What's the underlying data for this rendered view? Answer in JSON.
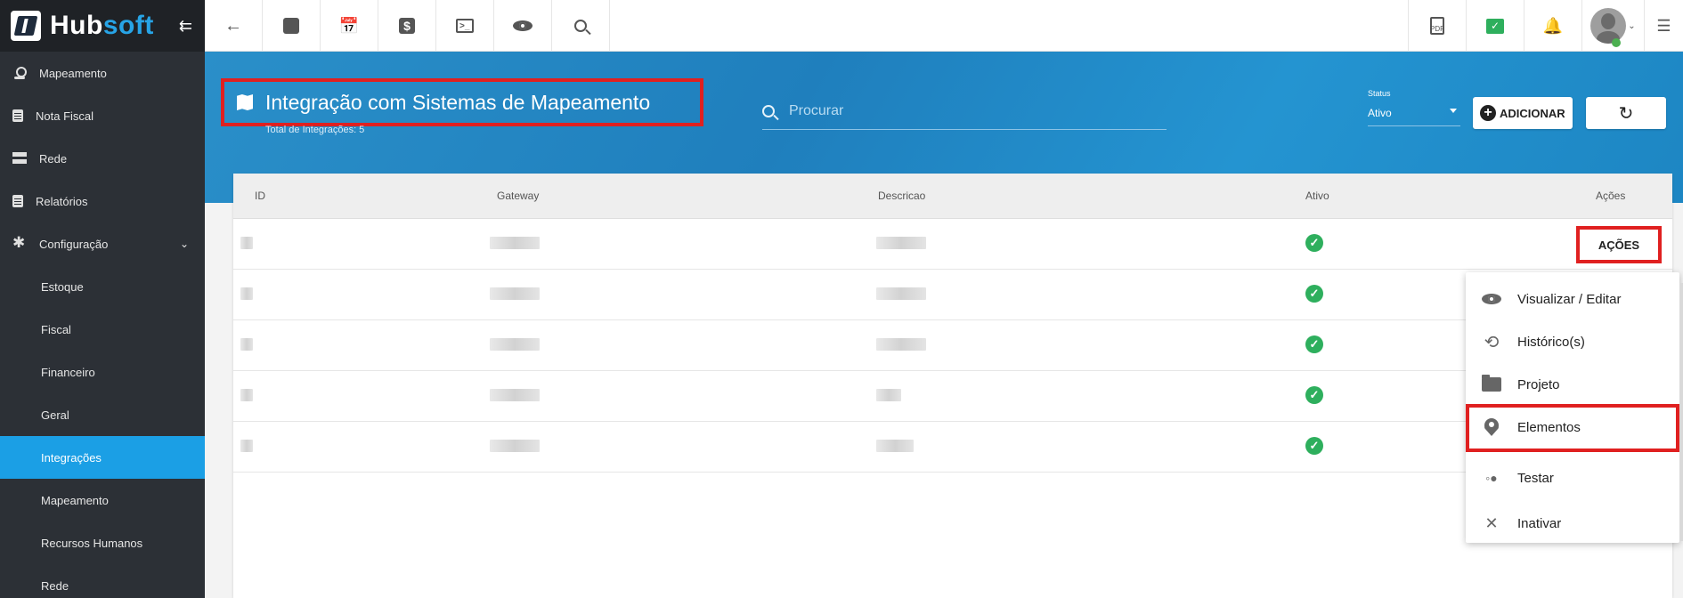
{
  "brand": {
    "name_part1": "Hub",
    "name_part2": "soft"
  },
  "sidebar": {
    "items": [
      {
        "label": "Mapeamento",
        "icon": "map-pin-icon"
      },
      {
        "label": "Nota Fiscal",
        "icon": "document-icon"
      },
      {
        "label": "Rede",
        "icon": "network-icon"
      },
      {
        "label": "Relatórios",
        "icon": "report-icon"
      },
      {
        "label": "Configuração",
        "icon": "gear-icon",
        "expanded": true
      }
    ],
    "subitems": [
      {
        "label": "Estoque"
      },
      {
        "label": "Fiscal"
      },
      {
        "label": "Financeiro"
      },
      {
        "label": "Geral"
      },
      {
        "label": "Integrações",
        "active": true
      },
      {
        "label": "Mapeamento"
      },
      {
        "label": "Recursos Humanos"
      },
      {
        "label": "Rede"
      }
    ]
  },
  "topbar": {
    "buttons": [
      "back-arrow-icon",
      "contact-card-icon",
      "calendar-clock-icon",
      "money-icon",
      "terminal-icon",
      "eye-icon",
      "search-icon"
    ],
    "right_buttons": [
      "pdf-icon",
      "chat-icon",
      "bell-icon",
      "avatar"
    ]
  },
  "header": {
    "title": "Integração com Sistemas de Mapeamento",
    "subtitle": "Total de Integrações: 5",
    "search_placeholder": "Procurar",
    "status_label": "Status",
    "status_value": "Ativo",
    "add_label": "ADICIONAR"
  },
  "table": {
    "columns": [
      "ID",
      "Gateway",
      "Descricao",
      "Ativo",
      "Ações"
    ],
    "rows": [
      {
        "ativo": true,
        "acoes": "AÇÕES"
      },
      {
        "ativo": true
      },
      {
        "ativo": true
      },
      {
        "ativo": true
      },
      {
        "ativo": true
      }
    ]
  },
  "menu": {
    "items": [
      {
        "label": "Visualizar / Editar",
        "icon": "eye-icon"
      },
      {
        "label": "Histórico(s)",
        "icon": "history-icon"
      },
      {
        "label": "Projeto",
        "icon": "folder-icon"
      },
      {
        "label": "Elementos",
        "icon": "location-pin-icon"
      },
      {
        "label": "Testar",
        "icon": "test-user-icon"
      },
      {
        "label": "Inativar",
        "icon": "close-icon"
      }
    ]
  },
  "colors": {
    "sidebar_bg": "#2c3036",
    "active_item": "#1b9fe5",
    "banner": "#2a8fc9",
    "highlight": "#e02020",
    "status_ok": "#2eaf5d"
  }
}
